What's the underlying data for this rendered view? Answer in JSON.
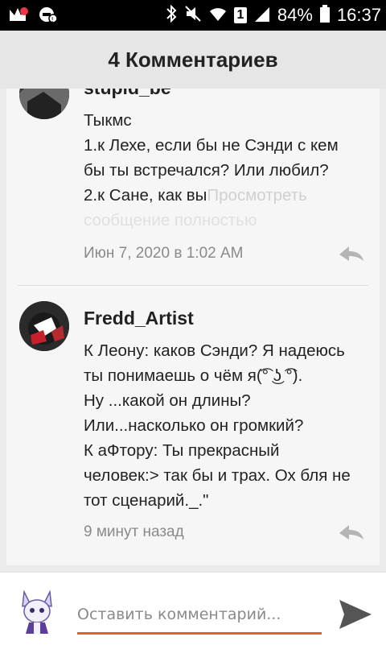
{
  "status_bar": {
    "battery": "84%",
    "time": "16:37",
    "sim": "1"
  },
  "header": {
    "title": "4 Комментариев"
  },
  "comments": [
    {
      "author": "stupid_be",
      "lines": [
        "Тыкмс",
        "1.к Лехе, если бы не Сэнди с кем",
        "бы ты встречался? Или любил?",
        "2.к Сане, как вы"
      ],
      "more_label": "Просмотреть",
      "more_label_2": "сообщение полностью",
      "time": "Июн 7, 2020 в 1:02 AM"
    },
    {
      "author": "Fredd_Artist",
      "lines": [
        "К Леону: каков Сэнди? Я надеюсь",
        "ты понимаешь о чём я(͡° ͜ʖ ͡°).",
        "Ну ...какой он длины?",
        "Или...насколько он громкий?",
        "К аФтору: Ты прекрасный",
        "человек:> так бы и трах. Ох бля не",
        "тот сценарий._.\""
      ],
      "time": "9 минут назад"
    }
  ],
  "footer": {
    "placeholder": "Оставить комментарий..."
  },
  "colors": {
    "accent": "#e8641e",
    "send_icon": "#555555"
  }
}
